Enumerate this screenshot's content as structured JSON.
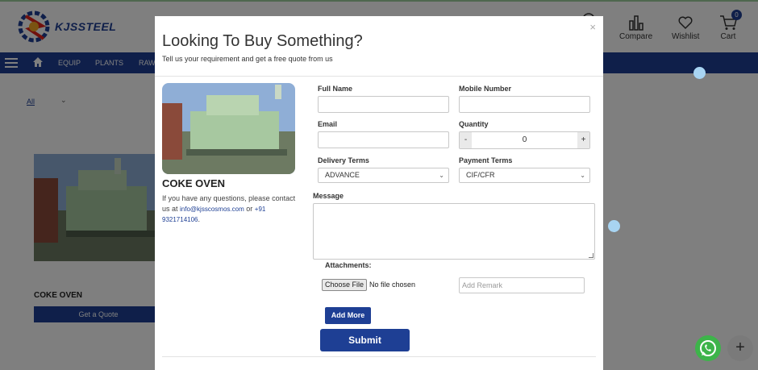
{
  "header": {
    "logo_text": "KJSSTEEL",
    "compare_label": "Compare",
    "wishlist_label": "Wishlist",
    "cart_label": "Cart",
    "cart_count": "0"
  },
  "nav": {
    "items": [
      "EQUIP",
      "PLANTS",
      "RAW"
    ]
  },
  "filter": {
    "all_label": "All"
  },
  "card": {
    "title": "COKE OVEN",
    "quote_label": "Get a Quote"
  },
  "modal": {
    "title": "Looking To Buy Something?",
    "subtitle": "Tell us your requirement and get a free quote from us",
    "close_label": "×",
    "product_name": "COKE OVEN",
    "contact_text": "If you have any questions, please contact us at",
    "contact_email": "info@kjsscosmos.com",
    "contact_or": "or",
    "contact_phone": "+91 9321714106",
    "form": {
      "full_name_label": "Full Name",
      "mobile_label": "Mobile Number",
      "email_label": "Email",
      "quantity_label": "Quantity",
      "quantity_value": "0",
      "qty_minus": "-",
      "qty_plus": "+",
      "delivery_label": "Delivery Terms",
      "delivery_value": "ADVANCE",
      "payment_label": "Payment Terms",
      "payment_value": "CIF/CFR",
      "message_label": "Message",
      "attachments_label": "Attachments:",
      "choose_file_label": "Choose File",
      "no_file_label": "No file chosen",
      "remark_placeholder": "Add Remark",
      "add_more_label": "Add More",
      "submit_label": "Submit"
    }
  },
  "colors": {
    "brand_blue": "#1e3f94",
    "whatsapp_green": "#3db44a"
  }
}
